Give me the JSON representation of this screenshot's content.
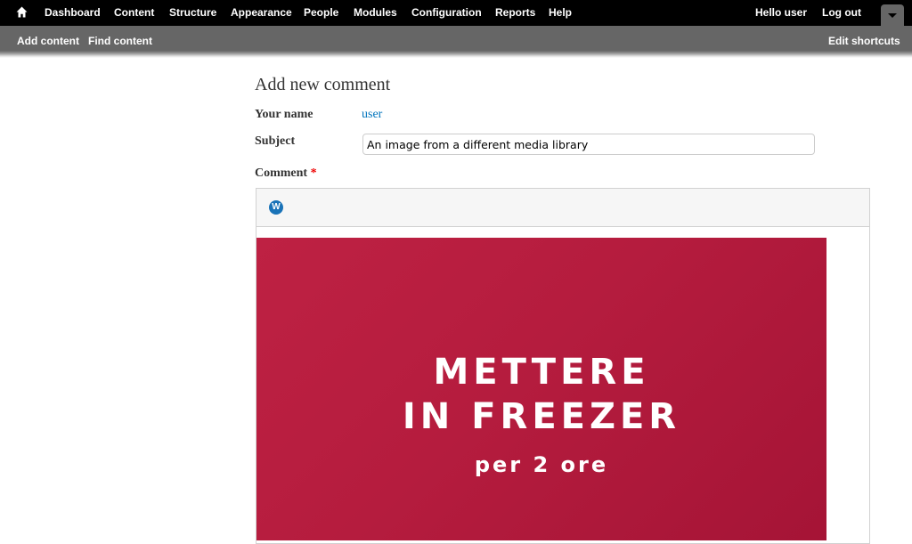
{
  "toolbar": {
    "home_icon": "home-icon",
    "menu": [
      {
        "label": "Dashboard"
      },
      {
        "label": "Content"
      },
      {
        "label": "Structure"
      },
      {
        "label": "Appearance"
      },
      {
        "label": "People"
      },
      {
        "label": "Modules"
      },
      {
        "label": "Configuration"
      },
      {
        "label": "Reports"
      },
      {
        "label": "Help"
      }
    ],
    "hello_prefix": "Hello ",
    "username": "user",
    "logout": "Log out",
    "toggle_icon": "triangle-down-icon"
  },
  "shortcuts": {
    "items": [
      {
        "label": "Add content"
      },
      {
        "label": "Find content"
      }
    ],
    "edit": "Edit shortcuts"
  },
  "form": {
    "title": "Add new comment",
    "your_name_label": "Your name",
    "your_name_value": "user",
    "subject_label": "Subject",
    "subject_value": "An image from a different media library",
    "comment_label": "Comment",
    "required_marker": "*",
    "editor": {
      "toolbar_button": "W",
      "toolbar_icon": "media-library-icon",
      "image_text": {
        "line1": "METTERE",
        "line2": "IN FREEZER",
        "line3": "per 2 ore"
      },
      "image_color": "#b51c3e"
    }
  }
}
